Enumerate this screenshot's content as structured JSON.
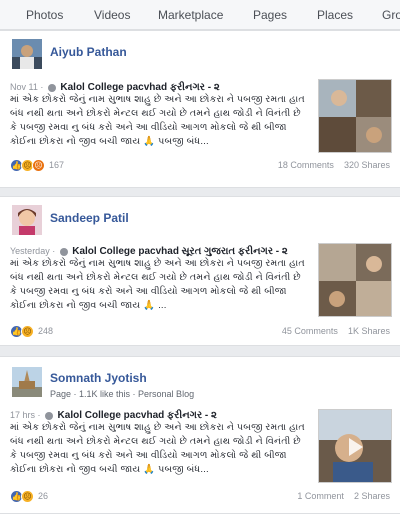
{
  "tabs": [
    "Photos",
    "Videos",
    "Marketplace",
    "Pages",
    "Places",
    "Gro"
  ],
  "posts": [
    {
      "author": "Aiyub Pathan",
      "date": "Nov 11 ·",
      "title": "Kalol College pacvhad ફરીનગર - ૨",
      "body": "માં એક છોકરો જેનું નામ સુભાષ શાહુ છે અને આ છોકરા ને પબજી રમતા હાત બંધ નથી થતા અને છોકરો મેન્ટલ થઈ ગયો છે તમને હાથ જોડી ને વિનંતી છે કે પબજી રમવા નુ બંધ કરો અને આ વીડિયો આગળ મોકલો જે થી બીજા કોઈના છોકરા નો જીવ બચી જાય 🙏 પબજી બંધ...",
      "reaction_count": "167",
      "comments": "18 Comments",
      "shares": "320 Shares"
    },
    {
      "author": "Sandeep Patil",
      "date": "Yesterday ·",
      "title": "Kalol College pacvhad",
      "title_extra": "સૂરત ગુજરાત ફરીનગર - ૨",
      "body": "માં એક છોકરો જેનું નામ સુભાષ શાહુ છે અને આ છોકરા ને પબજી રમતા હાત બંધ નથી થતા અને છોકરો મેન્ટલ થઈ ગયો છે તમને હાથ જોડી ને વિનંતી છે કે પબજી રમવા નુ બંધ કરો અને આ વીડિયો આગળ મોકલો જે થી બીજા કોઈના છોકરા નો જીવ બચી જાય 🙏 ...",
      "reaction_count": "248",
      "comments": "45 Comments",
      "shares": "1K Shares"
    },
    {
      "author": "Somnath Jyotish",
      "subline": "Page · 1.1K like this · Personal Blog",
      "date": "17 hrs ·",
      "title": "Kalol College pacvhad ફરીનગર - ૨",
      "body": "માં એક છોકરો જેનું નામ સુભાષ શાહુ છે અને આ છોકરા ને પબજી રમતા હાત બંધ નથી થતા અને છોકરો મેન્ટલ થઈ ગયો છે તમને હાથ જોડી ને વિનંતી છે કે પબજી રમવા નુ બંધ કરો અને આ વીડિયો આગળ મોકલો જે થી બીજા કોઈના છોકરા નો જીવ બચી જાય 🙏 પબજી બંધ...",
      "reaction_count": "26",
      "comments": "1 Comment",
      "shares": "2 Shares"
    }
  ],
  "icons": {
    "like": "like-reaction-icon",
    "sad": "sad-reaction-icon",
    "angry": "angry-reaction-icon",
    "globe": "globe-icon"
  },
  "colors": {
    "link": "#365899",
    "like": "#4267b2",
    "sad": "#f7b125",
    "angry": "#e9710f",
    "background": "#e9ebee"
  }
}
